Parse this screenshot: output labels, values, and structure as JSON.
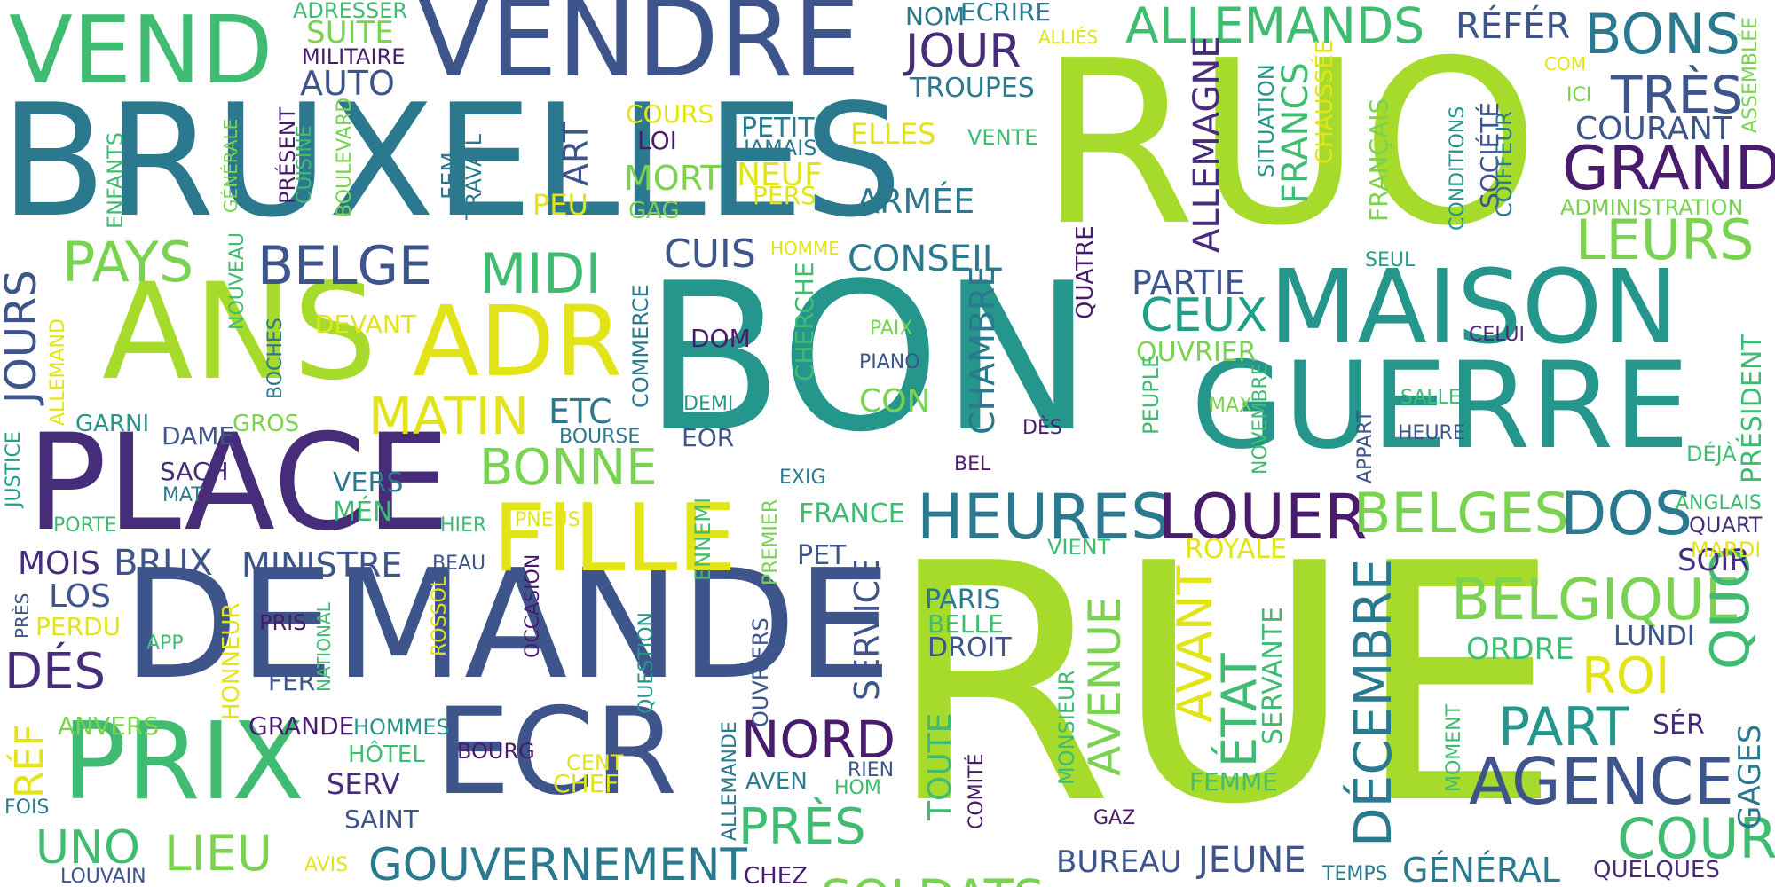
{
  "palette": {
    "a": "#a6da2b",
    "b": "#2a798e",
    "c": "#24968b",
    "d": "#3d558b",
    "e": "#3fbb72",
    "f": "#e3e418",
    "g": "#481b6d",
    "h": "#7ad251",
    "i": "#472c7a",
    "j": "#1f9f88"
  },
  "words": [
    {
      "t": "RUE",
      "c": "a"
    },
    {
      "t": "RUO",
      "c": "a"
    },
    {
      "t": "BON",
      "c": "c"
    },
    {
      "t": "BRUXELLES",
      "c": "b"
    },
    {
      "t": "DEMANDE",
      "c": "d"
    },
    {
      "t": "VENDRE",
      "c": "d"
    },
    {
      "t": "PLACE",
      "c": "i"
    },
    {
      "t": "ANS",
      "c": "a"
    },
    {
      "t": "GUERRE",
      "c": "c"
    },
    {
      "t": "MAISON",
      "c": "c"
    },
    {
      "t": "ECR",
      "c": "d"
    },
    {
      "t": "PRIX",
      "c": "e"
    },
    {
      "t": "VEND",
      "c": "e"
    },
    {
      "t": "ADR",
      "c": "f"
    },
    {
      "t": "FILLE",
      "c": "f"
    },
    {
      "t": "GRAND",
      "c": "g"
    },
    {
      "t": "BONS",
      "c": "b"
    },
    {
      "t": "ALLEMANDS",
      "c": "e"
    },
    {
      "t": "TRÈS",
      "c": "d"
    },
    {
      "t": "LEURS",
      "c": "h"
    },
    {
      "t": "HEURES",
      "c": "b"
    },
    {
      "t": "LOUER",
      "c": "g"
    },
    {
      "t": "BELGES",
      "c": "h"
    },
    {
      "t": "DOS",
      "c": "b"
    },
    {
      "t": "BELGIQUE",
      "c": "h"
    },
    {
      "t": "AGENCE",
      "c": "d"
    },
    {
      "t": "PART",
      "c": "c"
    },
    {
      "t": "COUR",
      "c": "e"
    },
    {
      "t": "ROI",
      "c": "f"
    },
    {
      "t": "QUO",
      "c": "e"
    },
    {
      "t": "PRÈS",
      "c": "e"
    },
    {
      "t": "NORD",
      "c": "g"
    },
    {
      "t": "SOLDATS",
      "c": "h"
    },
    {
      "t": "GOUVERNEMENT",
      "c": "b"
    },
    {
      "t": "LIEU",
      "c": "h"
    },
    {
      "t": "UNO",
      "c": "e"
    },
    {
      "t": "BELGE",
      "c": "d"
    },
    {
      "t": "PAYS",
      "c": "h"
    },
    {
      "t": "MIDI",
      "c": "e"
    },
    {
      "t": "MATIN",
      "c": "f"
    },
    {
      "t": "BONNE",
      "c": "h"
    },
    {
      "t": "JOUR",
      "c": "i"
    },
    {
      "t": "CEUX",
      "c": "j"
    },
    {
      "t": "PARTIE",
      "c": "d"
    },
    {
      "t": "AVENUE",
      "c": "h"
    },
    {
      "t": "AVANT",
      "c": "f"
    },
    {
      "t": "ÉTAT",
      "c": "e"
    },
    {
      "t": "DÉCEMBRE",
      "c": "b"
    },
    {
      "t": "DÉS",
      "c": "i"
    },
    {
      "t": "JOURS",
      "c": "d"
    },
    {
      "t": "MOIS",
      "c": "i"
    },
    {
      "t": "BRUX",
      "c": "d"
    },
    {
      "t": "MINISTRE",
      "c": "d"
    },
    {
      "t": "ARMÉE",
      "c": "b"
    },
    {
      "t": "CONSEIL",
      "c": "b"
    },
    {
      "t": "CUIS",
      "c": "d"
    },
    {
      "t": "AUTO",
      "c": "d"
    },
    {
      "t": "COURANT",
      "c": "d"
    },
    {
      "t": "RÉFÉR",
      "c": "d"
    },
    {
      "t": "SUITE",
      "c": "h"
    },
    {
      "t": "MILITAIRE",
      "c": "g"
    },
    {
      "t": "ADRESSER",
      "c": "e"
    },
    {
      "t": "NOM",
      "c": "b"
    },
    {
      "t": "ECRIRE",
      "c": "b"
    },
    {
      "t": "TROUPES",
      "c": "b"
    },
    {
      "t": "ALLIÉS",
      "c": "f"
    },
    {
      "t": "COM",
      "c": "f"
    },
    {
      "t": "ICI",
      "c": "h"
    },
    {
      "t": "ASSEMBLÉE",
      "c": "h"
    },
    {
      "t": "ADMINISTRATION",
      "c": "h"
    },
    {
      "t": "ALLEMAGNE",
      "c": "i"
    },
    {
      "t": "FRANCS",
      "c": "e"
    },
    {
      "t": "CHAUSSÉE",
      "c": "f"
    },
    {
      "t": "FRANÇAIS",
      "c": "h"
    },
    {
      "t": "SITUATION",
      "c": "c"
    },
    {
      "t": "CONDITIONS",
      "c": "c"
    },
    {
      "t": "SOCIÉTÉ",
      "c": "d"
    },
    {
      "t": "COIFFEUR",
      "c": "b"
    },
    {
      "t": "COURS",
      "c": "f"
    },
    {
      "t": "LOI",
      "c": "g"
    },
    {
      "t": "PETIT",
      "c": "b"
    },
    {
      "t": "JAMAIS",
      "c": "b"
    },
    {
      "t": "ELLES",
      "c": "f"
    },
    {
      "t": "VENTE",
      "c": "e"
    },
    {
      "t": "NEUF",
      "c": "f"
    },
    {
      "t": "PERS",
      "c": "f"
    },
    {
      "t": "MORT",
      "c": "h"
    },
    {
      "t": "GAG",
      "c": "h"
    },
    {
      "t": "PEU",
      "c": "f"
    },
    {
      "t": "ART",
      "c": "d"
    },
    {
      "t": "FEM",
      "c": "b"
    },
    {
      "t": "TRAVAIL",
      "c": "b"
    },
    {
      "t": "ENFANTS",
      "c": "e"
    },
    {
      "t": "GÉNÉRALE",
      "c": "h"
    },
    {
      "t": "PRÉSENT",
      "c": "g"
    },
    {
      "t": "CUISINE",
      "c": "e"
    },
    {
      "t": "BOULEVARD",
      "c": "h"
    },
    {
      "t": "HOMME",
      "c": "f"
    },
    {
      "t": "NOUVEAU",
      "c": "e"
    },
    {
      "t": "DEVANT",
      "c": "f"
    },
    {
      "t": "BOCHES",
      "c": "b"
    },
    {
      "t": "ALLEMAND",
      "c": "f"
    },
    {
      "t": "GARNI",
      "c": "c"
    },
    {
      "t": "DAME",
      "c": "d"
    },
    {
      "t": "GROS",
      "c": "h"
    },
    {
      "t": "JUSTICE",
      "c": "j"
    },
    {
      "t": "SACH",
      "c": "i"
    },
    {
      "t": "MAT",
      "c": "b"
    },
    {
      "t": "VERS",
      "c": "b"
    },
    {
      "t": "MÉN",
      "c": "e"
    },
    {
      "t": "PORTE",
      "c": "e"
    },
    {
      "t": "HIER",
      "c": "e"
    },
    {
      "t": "PNEUS",
      "c": "f"
    },
    {
      "t": "BEAU",
      "c": "d"
    },
    {
      "t": "LOS",
      "c": "d"
    },
    {
      "t": "PRÈS",
      "c": "d"
    },
    {
      "t": "PERDU",
      "c": "f"
    },
    {
      "t": "APP",
      "c": "e"
    },
    {
      "t": "PRIS",
      "c": "g"
    },
    {
      "t": "FER",
      "c": "d"
    },
    {
      "t": "NATIONAL",
      "c": "e"
    },
    {
      "t": "ROSSOL",
      "c": "f"
    },
    {
      "t": "HONNEUR",
      "c": "f"
    },
    {
      "t": "OCCASION",
      "c": "g"
    },
    {
      "t": "QUESTION",
      "c": "c"
    },
    {
      "t": "ENNEMI",
      "c": "e"
    },
    {
      "t": "PREMIER",
      "c": "h"
    },
    {
      "t": "GRANDE",
      "c": "g"
    },
    {
      "t": "HOMMES",
      "c": "c"
    },
    {
      "t": "HÔTEL",
      "c": "e"
    },
    {
      "t": "BOURG",
      "c": "g"
    },
    {
      "t": "SERV",
      "c": "i"
    },
    {
      "t": "SAINT",
      "c": "d"
    },
    {
      "t": "ANVERS",
      "c": "h"
    },
    {
      "t": "RÉF",
      "c": "f"
    },
    {
      "t": "FOIS",
      "c": "b"
    },
    {
      "t": "LOUVAIN",
      "c": "d"
    },
    {
      "t": "AVIS",
      "c": "f"
    },
    {
      "t": "CHEZ",
      "c": "g"
    },
    {
      "t": "CENT",
      "c": "f"
    },
    {
      "t": "CHEF",
      "c": "f"
    },
    {
      "t": "AVEN",
      "c": "b"
    },
    {
      "t": "RIEN",
      "c": "d"
    },
    {
      "t": "HOM",
      "c": "e"
    },
    {
      "t": "ALLEMANDE",
      "c": "b"
    },
    {
      "t": "OUVRIERS",
      "c": "d"
    },
    {
      "t": "PET",
      "c": "d"
    },
    {
      "t": "FRANCE",
      "c": "e"
    },
    {
      "t": "EXIG",
      "c": "b"
    },
    {
      "t": "SERVICE",
      "c": "d"
    },
    {
      "t": "DOM",
      "c": "g"
    },
    {
      "t": "DEMI",
      "c": "c"
    },
    {
      "t": "EOR",
      "c": "d"
    },
    {
      "t": "ETC",
      "c": "b"
    },
    {
      "t": "BOURSE",
      "c": "b"
    },
    {
      "t": "COMMERCE",
      "c": "b"
    },
    {
      "t": "CHERCHE",
      "c": "e"
    },
    {
      "t": "PAIX",
      "c": "h"
    },
    {
      "t": "PIANO",
      "c": "d"
    },
    {
      "t": "CON",
      "c": "h"
    },
    {
      "t": "CHAMBRE",
      "c": "b"
    },
    {
      "t": "QUATRE",
      "c": "g"
    },
    {
      "t": "DÈS",
      "c": "g"
    },
    {
      "t": "BEL",
      "c": "g"
    },
    {
      "t": "TOUTE",
      "c": "e"
    },
    {
      "t": "COMITÉ",
      "c": "g"
    },
    {
      "t": "PARIS",
      "c": "b"
    },
    {
      "t": "BELLE",
      "c": "e"
    },
    {
      "t": "DROIT",
      "c": "d"
    },
    {
      "t": "VIENT",
      "c": "e"
    },
    {
      "t": "OUVRIER",
      "c": "h"
    },
    {
      "t": "PEUPLE",
      "c": "e"
    },
    {
      "t": "NOVEMBRE",
      "c": "e"
    },
    {
      "t": "MAX",
      "c": "h"
    },
    {
      "t": "ROYALE",
      "c": "f"
    },
    {
      "t": "SERVANTE",
      "c": "e"
    },
    {
      "t": "MONSIEUR",
      "c": "e"
    },
    {
      "t": "FEMME",
      "c": "e"
    },
    {
      "t": "GAZ",
      "c": "g"
    },
    {
      "t": "BUREAU",
      "c": "d"
    },
    {
      "t": "JEUNE",
      "c": "d"
    },
    {
      "t": "TEMPS",
      "c": "b"
    },
    {
      "t": "GÉNÉRAL",
      "c": "b"
    },
    {
      "t": "QUELQUES",
      "c": "i"
    },
    {
      "t": "MOMENT",
      "c": "e"
    },
    {
      "t": "SÉR",
      "c": "i"
    },
    {
      "t": "GAGES",
      "c": "b"
    },
    {
      "t": "LUNDI",
      "c": "d"
    },
    {
      "t": "ORDRE",
      "c": "e"
    },
    {
      "t": "SOIR",
      "c": "i"
    },
    {
      "t": "MARDI",
      "c": "f"
    },
    {
      "t": "QUART",
      "c": "i"
    },
    {
      "t": "ANGLAIS",
      "c": "e"
    },
    {
      "t": "DÉJÀ",
      "c": "e"
    },
    {
      "t": "PRÉSIDENT",
      "c": "e"
    },
    {
      "t": "SALLE",
      "c": "e"
    },
    {
      "t": "HEURE",
      "c": "d"
    },
    {
      "t": "APPART",
      "c": "d"
    },
    {
      "t": "CELUI",
      "c": "i"
    },
    {
      "t": "SEUL",
      "c": "j"
    }
  ]
}
